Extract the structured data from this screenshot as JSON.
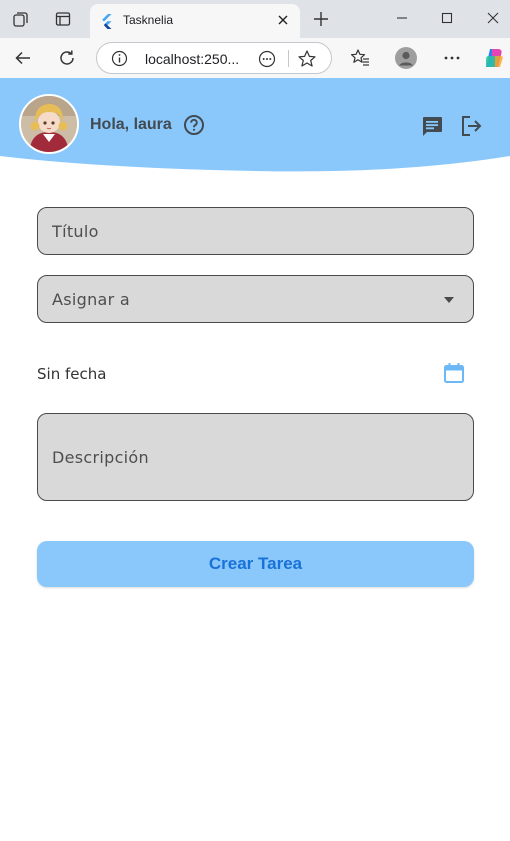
{
  "browser": {
    "tab_title": "Tasknelia",
    "url": "localhost:250...",
    "icons": [
      "workspaces-icon",
      "tab-actions-icon",
      "flutter-favicon",
      "close-tab-icon",
      "new-tab-icon",
      "minimize-icon",
      "maximize-icon",
      "close-window-icon",
      "back-icon",
      "refresh-icon",
      "site-info-icon",
      "more-options-icon",
      "favorite-star-icon",
      "favorites-icon",
      "profile-icon",
      "settings-more-icon",
      "copilot-icon"
    ]
  },
  "header": {
    "greeting": "Hola, laura",
    "icons": [
      "avatar",
      "help-icon",
      "chat-icon",
      "logout-icon"
    ],
    "colors": {
      "header_bg": "#8ac8fb",
      "icon": "#424a52"
    }
  },
  "form": {
    "title_label": "Título",
    "assign_label": "Asignar a",
    "date_text": "Sin fecha",
    "description_label": "Descripción",
    "create_button": "Crear Tarea",
    "colors": {
      "field_bg": "#d9d9d9",
      "button_bg": "#8ac8fb",
      "button_text": "#1a72d9",
      "calendar_icon": "#6cb8f7"
    }
  }
}
